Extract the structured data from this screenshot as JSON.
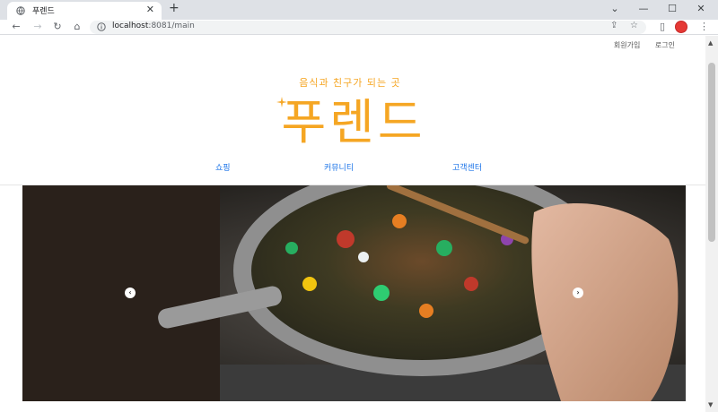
{
  "browser": {
    "tab_title": "푸렌드",
    "tab_close": "✕",
    "new_tab": "+",
    "url_host": "localhost",
    "url_path": ":8081/main",
    "window_controls": [
      "⌄",
      "—",
      "☐",
      "✕"
    ]
  },
  "header": {
    "links": [
      "회원가입",
      "로그인"
    ],
    "tagline": "음식과 친구가 되는 곳",
    "logo": "푸렌드"
  },
  "nav": {
    "items": [
      "쇼핑",
      "커뮤니티",
      "고객센터"
    ]
  },
  "carousel": {
    "prev": "‹",
    "next": "›",
    "slide_count": 3,
    "active_index": 0,
    "image_subject": "stir-fry vegetables in a pan on a stove"
  }
}
